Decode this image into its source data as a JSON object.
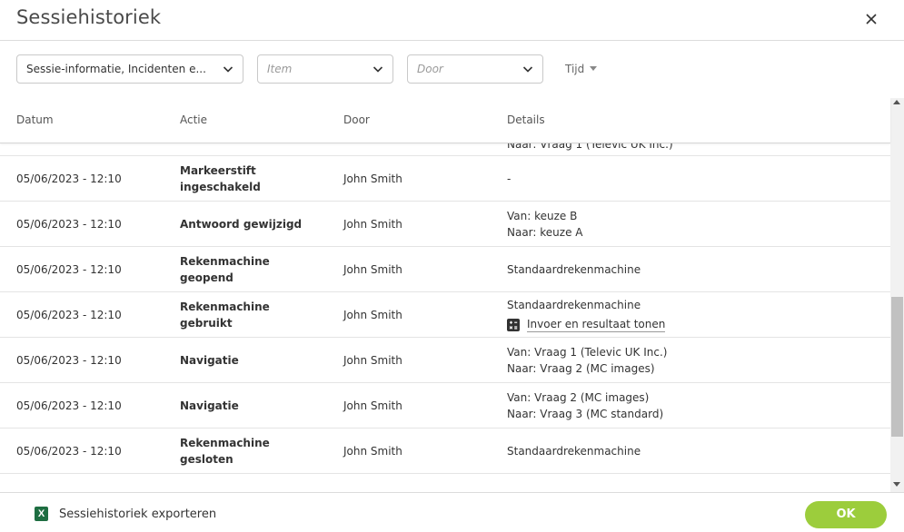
{
  "dialog": {
    "title": "Sessiehistoriek"
  },
  "filters": {
    "category": {
      "value": "Sessie-informatie, Incidenten e..."
    },
    "item": {
      "placeholder": "Item"
    },
    "door": {
      "placeholder": "Door"
    },
    "tijd_label": "Tijd"
  },
  "table": {
    "columns": [
      "Datum",
      "Actie",
      "Door",
      "Details"
    ],
    "partial_detail": "Naar: Vraag 1 (Televic UK Inc.)",
    "rows": [
      {
        "date": "05/06/2023 - 12:10",
        "action": "Markeerstift ingeschakeld",
        "by": "John Smith",
        "details": [
          "-"
        ]
      },
      {
        "date": "05/06/2023 - 12:10",
        "action": "Antwoord gewijzigd",
        "by": "John Smith",
        "details": [
          "Van: keuze B",
          "Naar: keuze A"
        ]
      },
      {
        "date": "05/06/2023 - 12:10",
        "action": "Rekenmachine geopend",
        "by": "John Smith",
        "details": [
          "Standaardrekenmachine"
        ]
      },
      {
        "date": "05/06/2023 - 12:10",
        "action": "Rekenmachine gebruikt",
        "by": "John Smith",
        "details": [
          "Standaardrekenmachine"
        ],
        "link": "Invoer en resultaat tonen"
      },
      {
        "date": "05/06/2023 - 12:10",
        "action": "Navigatie",
        "by": "John Smith",
        "details": [
          "Van: Vraag 1 (Televic UK Inc.)",
          "Naar: Vraag 2 (MC images)"
        ]
      },
      {
        "date": "05/06/2023 - 12:10",
        "action": "Navigatie",
        "by": "John Smith",
        "details": [
          "Van: Vraag 2 (MC images)",
          "Naar: Vraag 3 (MC standard)"
        ]
      },
      {
        "date": "05/06/2023 - 12:10",
        "action": "Rekenmachine gesloten",
        "by": "John Smith",
        "details": [
          "Standaardrekenmachine"
        ]
      }
    ]
  },
  "footer": {
    "export_label": "Sessiehistoriek exporteren",
    "ok_label": "OK"
  },
  "colors": {
    "accent": "#9ccd3c",
    "excel": "#1e6e42"
  }
}
